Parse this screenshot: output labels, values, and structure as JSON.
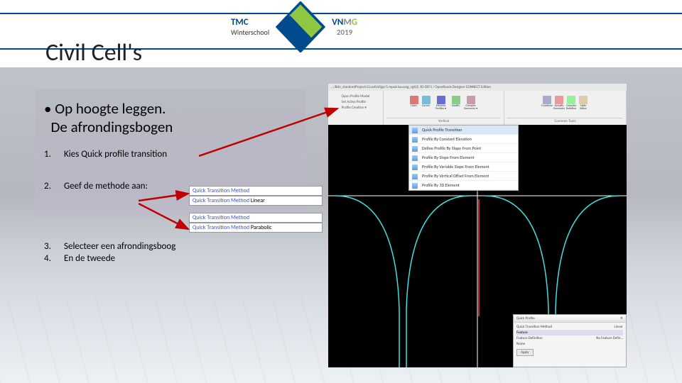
{
  "slide": {
    "title": "Civil Cell's",
    "bullet1_line1": "• Op hoogte leggen.",
    "bullet1_line2": "De afrondingsbogen",
    "steps": [
      {
        "n": "1.",
        "text": "Kies Quick profile transition"
      },
      {
        "n": "2.",
        "text": "Geef de methode aan:"
      },
      {
        "n": "3.",
        "text": "Selecteer een afrondingsboog"
      },
      {
        "n": "4.",
        "text": "En de tweede"
      }
    ]
  },
  "header": {
    "tmc": "TMC",
    "tmc_sub": "Winterschool",
    "vnmg_vn": "VN",
    "vnmg_m": "M",
    "vnmg_g": "G",
    "vnmg_year": "2019"
  },
  "option_labels": {
    "label": "Quick Transition Method",
    "row2_val": "Linear",
    "row4_val": "Parabolic"
  },
  "screenshot": {
    "path": ".../Bdn_standardProject/2.LastUsfJgn/5 repub buuang_cgt(2) 3D-DEF1 / OpenRoads Designer CONNECT Edition",
    "side": {
      "open_model": "Open Profile Model",
      "active_profile": "Set Active Profile",
      "creation": "Profile Creation ▾"
    },
    "ribbon": {
      "panel2": {
        "items": [
          "Lines",
          "Curves",
          "Element Profiles ▾",
          "Modify",
          "Complex Geometry ▾"
        ],
        "title": "Vertical"
      },
      "panel3": {
        "items": [
          "Transform",
          "Simplify Geometry",
          "Complex Redefine",
          "Table Editor"
        ],
        "title": "Common Tools"
      }
    },
    "dropdown": [
      "Quick Profile Transition",
      "Profile By Constant Elevation",
      "Define Profile By Slope From Point",
      "Profile By Slope From Element",
      "Profile By Variable Slope From Element",
      "Profile By Vertical Offset From Element",
      "Profile By 3D Element"
    ],
    "props": {
      "title": "Quick Profile",
      "close": "✕",
      "rows": [
        {
          "k": "Quick Transition Method",
          "v": "Linear"
        },
        {
          "k": "Feature",
          "v": ""
        },
        {
          "k": "Feature Definition",
          "v": "No Feature Defin…"
        },
        {
          "k": "Name",
          "v": ""
        }
      ],
      "btn": "Apply"
    }
  }
}
